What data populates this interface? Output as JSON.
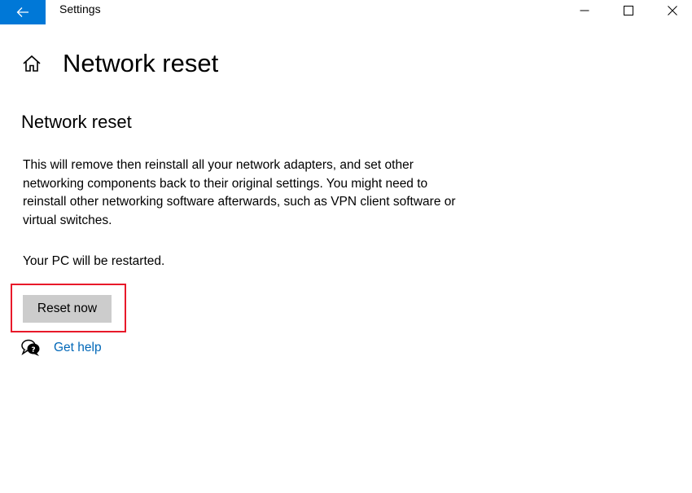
{
  "window": {
    "app_title": "Settings",
    "back_icon": "back-arrow-icon",
    "controls": {
      "minimize_icon": "minimize-icon",
      "maximize_icon": "maximize-icon",
      "close_icon": "close-icon"
    }
  },
  "header": {
    "home_icon": "home-icon",
    "title": "Network reset"
  },
  "main": {
    "section_title": "Network reset",
    "description": "This will remove then reinstall all your network adapters, and set other networking components back to their original settings. You might need to reinstall other networking software afterwards, such as VPN client software or virtual switches.",
    "restart_note": "Your PC will be restarted.",
    "reset_button_label": "Reset now",
    "help_icon": "chat-help-icon",
    "help_link": "Get help"
  },
  "colors": {
    "accent": "#0078d7",
    "link": "#0067b8",
    "button_bg": "#cccccc",
    "highlight_border": "#e8192a"
  }
}
